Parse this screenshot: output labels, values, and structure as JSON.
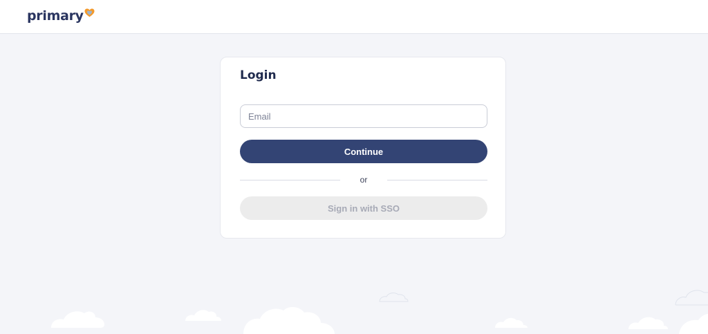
{
  "header": {
    "logo_text": "primary",
    "logo_heart_color": "#f39a2d",
    "logo_heart_inner_color": "#8fb8e8"
  },
  "login": {
    "title": "Login",
    "email_placeholder": "Email",
    "email_value": "",
    "continue_label": "Continue",
    "divider_text": "or",
    "sso_label": "Sign in with SSO"
  },
  "colors": {
    "page_background": "#f4f5f9",
    "primary_button": "#334474",
    "disabled_button": "#ececec",
    "title_text": "#1f2a4d"
  }
}
